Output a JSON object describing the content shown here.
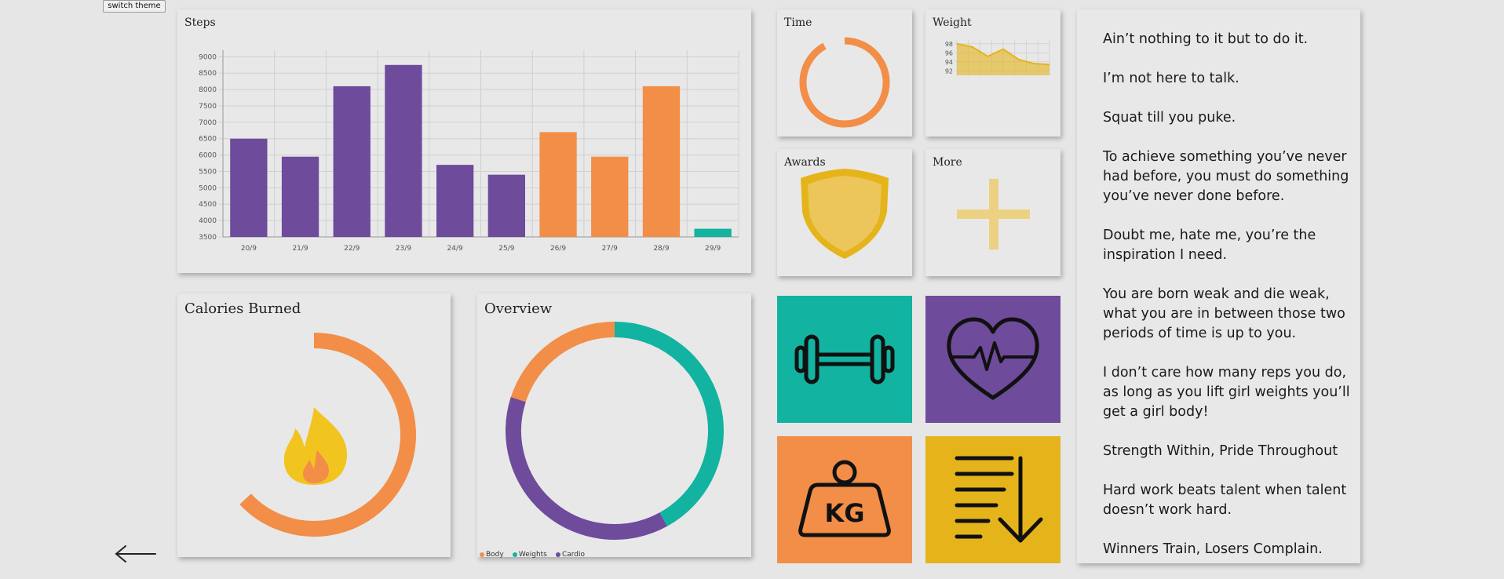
{
  "switch_theme_label": "switch theme",
  "colors": {
    "purple": "#6e4b9b",
    "orange": "#f28e48",
    "teal": "#12b3a0",
    "yellow": "#e5b41a",
    "card_bg": "#e8e8e8",
    "page_bg": "#e6e6e6"
  },
  "steps_card": {
    "title": "Steps"
  },
  "time_card": {
    "title": "Time",
    "progress_fraction": 0.92
  },
  "weight_card": {
    "title": "Weight"
  },
  "awards_card": {
    "title": "Awards",
    "icon": "shield-icon"
  },
  "more_card": {
    "title": "More",
    "icon": "plus-icon"
  },
  "calories_card": {
    "title": "Calories Burned",
    "progress_fraction": 0.63,
    "icon": "flame-icon"
  },
  "overview_card": {
    "title": "Overview",
    "legend": [
      {
        "label": "Body",
        "color": "#f28e48"
      },
      {
        "label": "Weights",
        "color": "#12b3a0"
      },
      {
        "label": "Cardio",
        "color": "#6e4b9b"
      }
    ]
  },
  "tiles": [
    {
      "icon": "dumbbell-icon",
      "color": "#12b3a0"
    },
    {
      "icon": "heart-rate-icon",
      "color": "#6e4b9b"
    },
    {
      "icon": "kettlebell-kg-icon",
      "color": "#f28e48",
      "text": "KG"
    },
    {
      "icon": "sort-descending-list-icon",
      "color": "#e5b41a"
    }
  ],
  "back_arrow_icon": "arrow-left-icon",
  "quotes": [
    "Ain’t nothing to it but to do it.",
    "I’m not here to talk.",
    "Squat till you puke.",
    "To achieve something you’ve never\nhad before, you must do something\n you’ve never done before.",
    "Doubt me, hate me, you’re the\ninspiration I need.",
    "You are born weak and die weak,\nwhat you are in between those two\nperiods of time is up to you.",
    "I don’t care how many reps you do,\n as long as you lift girl weights you’ll\n get a girl body!",
    "Strength Within, Pride Throughout",
    "Hard work beats talent when talent\n doesn’t work hard.",
    "Winners Train, Losers Complain."
  ],
  "chart_data": [
    {
      "type": "bar",
      "title": "Steps",
      "categories": [
        "20/9",
        "21/9",
        "22/9",
        "23/9",
        "24/9",
        "25/9",
        "26/9",
        "27/9",
        "28/9",
        "29/9"
      ],
      "values": [
        6500,
        5950,
        8100,
        8750,
        5700,
        5400,
        6700,
        5950,
        8100,
        3750
      ],
      "bar_colors": [
        "#6e4b9b",
        "#6e4b9b",
        "#6e4b9b",
        "#6e4b9b",
        "#6e4b9b",
        "#6e4b9b",
        "#f28e48",
        "#f28e48",
        "#f28e48",
        "#12b3a0"
      ],
      "yticks": [
        3500,
        4000,
        4500,
        5000,
        5500,
        6000,
        6500,
        7000,
        7500,
        8000,
        8500,
        9000
      ],
      "ylim": [
        3500,
        9200
      ],
      "grid": true
    },
    {
      "type": "area",
      "title": "Weight",
      "yticks": [
        92,
        94,
        96,
        98
      ],
      "ylim": [
        91,
        99
      ],
      "values": [
        98,
        97.3,
        95.2,
        96.8,
        94.5,
        93.6,
        93.4
      ],
      "color": "#e5b41a",
      "grid": true
    },
    {
      "type": "pie",
      "title": "Overview",
      "donut": true,
      "slices": [
        {
          "label": "Weights",
          "value": 42,
          "color": "#12b3a0"
        },
        {
          "label": "Cardio",
          "value": 38,
          "color": "#6e4b9b"
        },
        {
          "label": "Body",
          "value": 20,
          "color": "#f28e48"
        }
      ]
    }
  ]
}
